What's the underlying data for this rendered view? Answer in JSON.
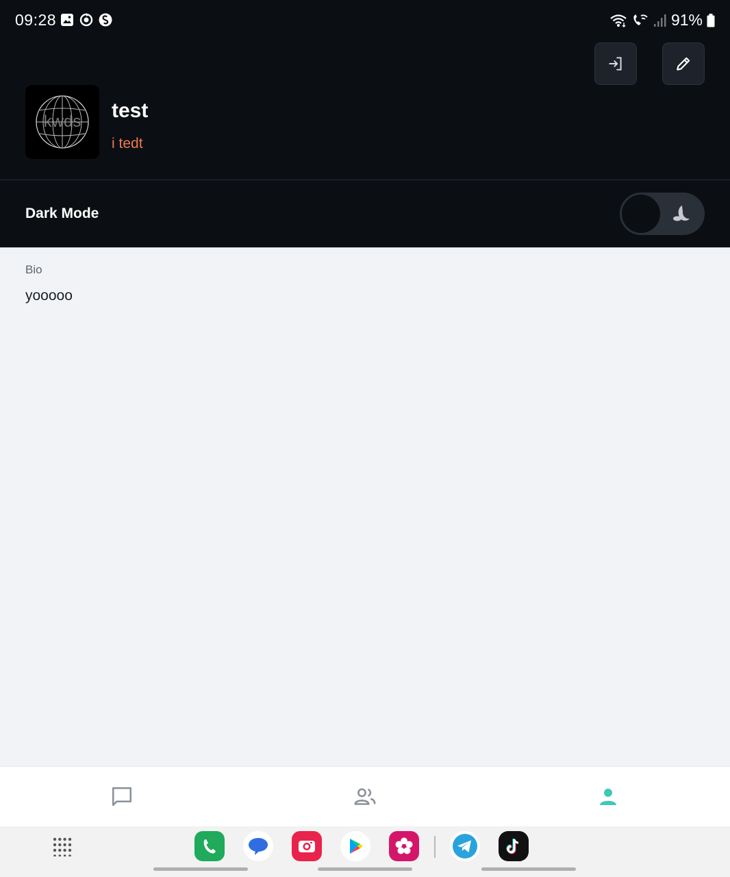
{
  "status_bar": {
    "time": "09:28",
    "battery": "91%",
    "left_icons": [
      "gallery-icon",
      "sync-icon",
      "shazam-icon"
    ],
    "right_icons": [
      "wifi-icon",
      "wifi-call-icon",
      "signal-icon",
      "battery-icon"
    ]
  },
  "header": {
    "login_button_icon": "login-icon",
    "edit_button_icon": "edit-pencil-icon",
    "avatar_text": "kwds",
    "username": "test",
    "subtitle": "i tedt"
  },
  "dark_mode": {
    "label": "Dark Mode",
    "icon": "moon-icon",
    "enabled": true
  },
  "bio": {
    "label": "Bio",
    "text": "yooooo"
  },
  "bottom_nav": {
    "items": [
      {
        "icon": "chat-icon",
        "active": false
      },
      {
        "icon": "groups-icon",
        "active": false
      },
      {
        "icon": "profile-icon",
        "active": true
      }
    ],
    "active_color": "#3ec8b8",
    "inactive_color": "#8a9099"
  },
  "dock": {
    "apps": [
      "phone-app-icon",
      "messages-app-icon",
      "camera-app-icon",
      "play-store-icon",
      "gallery-flower-icon",
      "telegram-icon",
      "tiktok-icon"
    ]
  },
  "colors": {
    "header_bg": "#0b0e13",
    "accent_orange": "#ef7a52",
    "content_bg": "#f1f3f7"
  }
}
